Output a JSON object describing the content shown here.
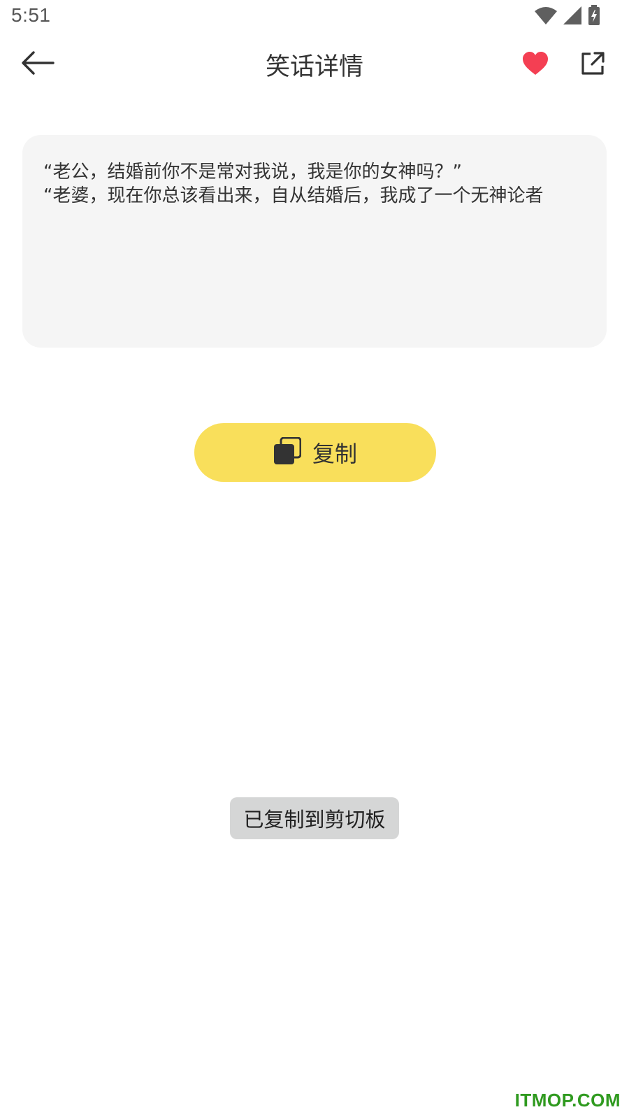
{
  "status_bar": {
    "time": "5:51",
    "icons": [
      "wifi-icon",
      "signal-icon",
      "battery-charging-icon"
    ]
  },
  "toolbar": {
    "title": "笑话详情",
    "back_icon": "arrow-left-icon",
    "favorite_icon": "heart-icon",
    "share_icon": "share-external-icon",
    "favorite_color": "#f43f53"
  },
  "joke": {
    "lines": [
      "“老公，结婚前你不是常对我说，我是你的女神吗？”",
      "“老婆，现在你总该看出来，自从结婚后，我成了一个无神论者"
    ]
  },
  "copy_button": {
    "label": "复制",
    "icon": "copy-icon",
    "color": "#f9df5b"
  },
  "toast": {
    "message": "已复制到剪切板"
  },
  "watermark": {
    "text": "ITMOP.COM",
    "color": "#2f9a1f"
  }
}
